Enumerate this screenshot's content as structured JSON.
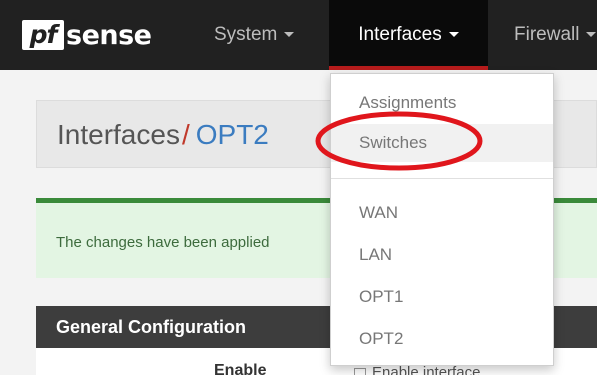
{
  "navbar": {
    "logo_pf": "pf",
    "logo_sense": "sense",
    "items": [
      {
        "label": "System"
      },
      {
        "label": "Interfaces"
      },
      {
        "label": "Firewall"
      }
    ]
  },
  "breadcrumb": {
    "root": "Interfaces",
    "separator": "/",
    "leaf": "OPT2"
  },
  "alert": {
    "message": "The changes have been applied"
  },
  "section": {
    "title": "General Configuration",
    "row_label": "Enable",
    "checkbox_label": "Enable interface"
  },
  "dropdown": {
    "items": [
      {
        "label": "Assignments"
      },
      {
        "label": "Switches"
      },
      {
        "label": "WAN"
      },
      {
        "label": "LAN"
      },
      {
        "label": "OPT1"
      },
      {
        "label": "OPT2"
      }
    ]
  },
  "colors": {
    "navbar_bg": "#212121",
    "active_underline": "#b71c1c",
    "link_blue": "#3b7cc0",
    "alert_green": "#3a8a3a",
    "annotation_red": "#e0161c"
  }
}
